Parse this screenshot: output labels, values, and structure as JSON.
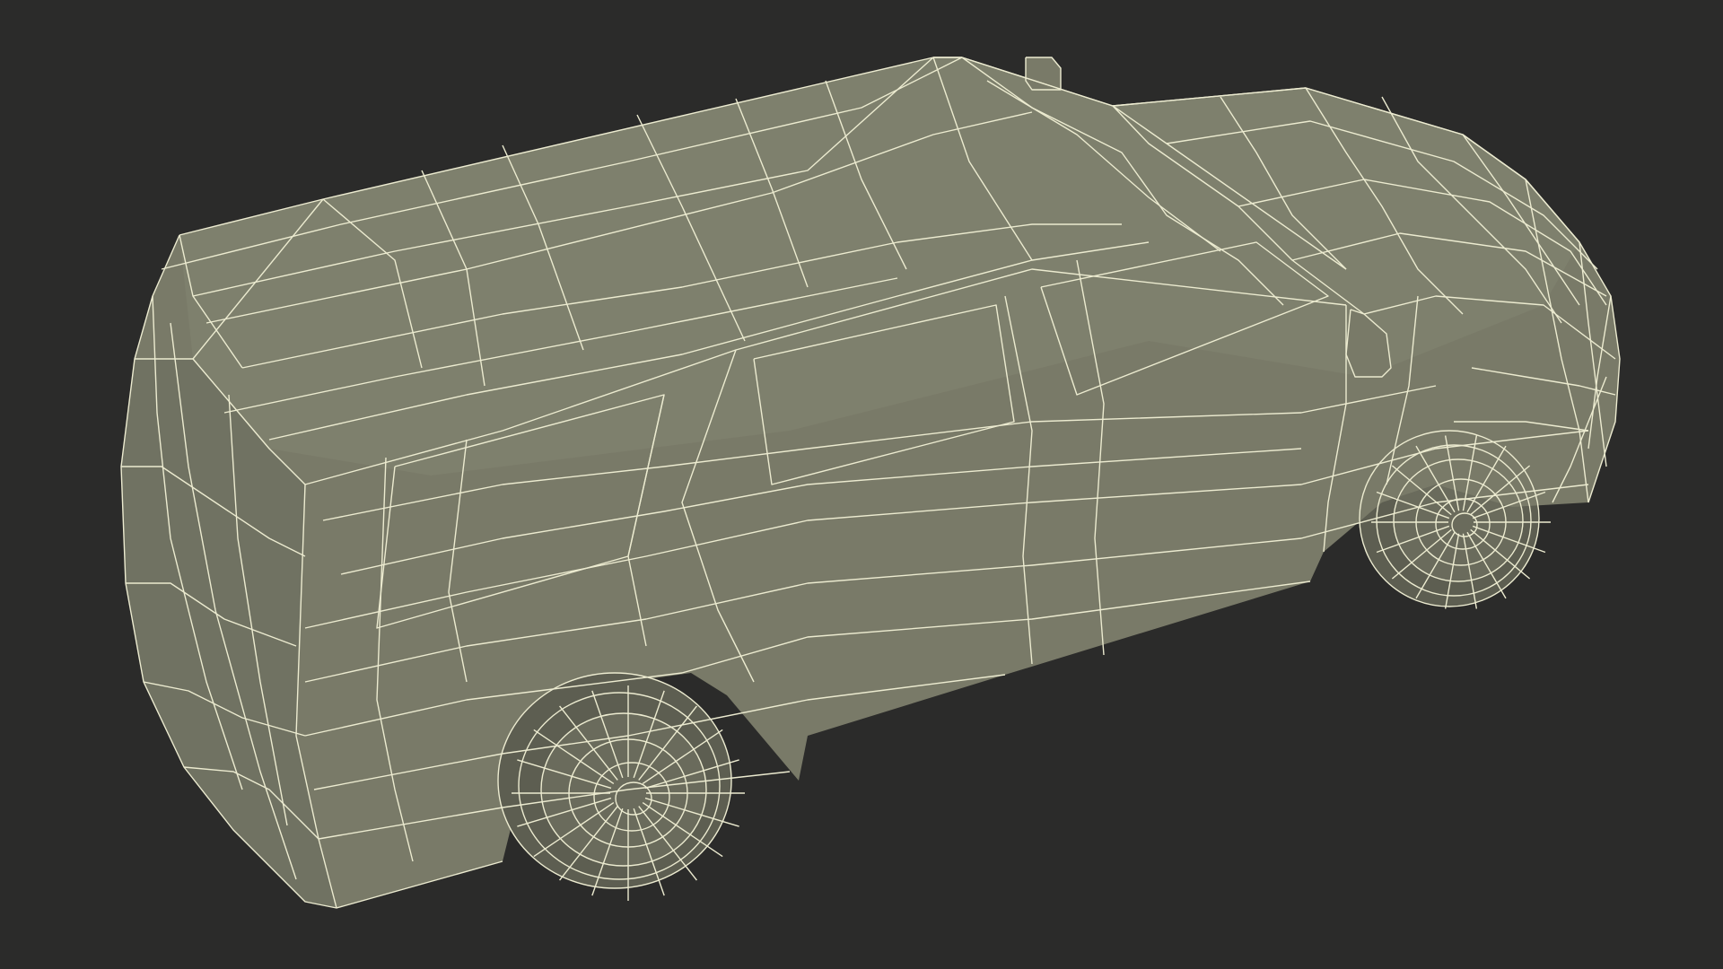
{
  "scene": {
    "subject": "car-wireframe",
    "background_color": "#2b2b2a",
    "surface_color": "#797a68",
    "wire_color": "#ecebd0"
  }
}
